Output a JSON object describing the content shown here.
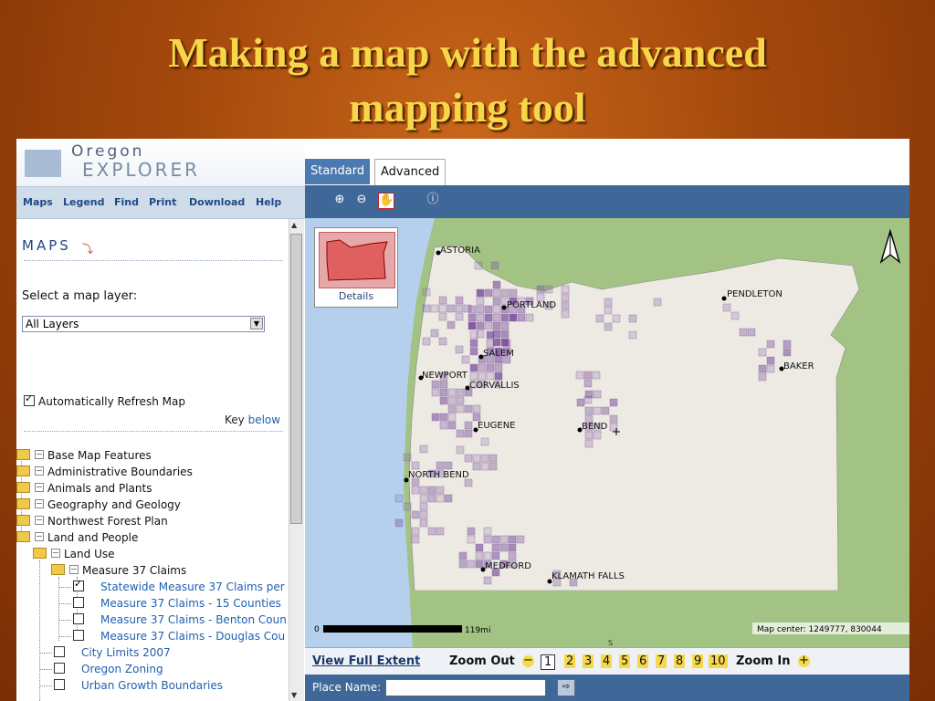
{
  "slide": {
    "title_line1": "Making a map with the advanced",
    "title_line2": "mapping tool"
  },
  "logo": {
    "line1": "Oregon",
    "line2": "EXPLORER"
  },
  "menu": [
    "Maps",
    "Legend",
    "Find",
    "Print",
    "Download",
    "Help"
  ],
  "maps_panel": {
    "header": "MAPS",
    "select_label": "Select a map layer:",
    "select_value": "All Layers",
    "auto_refresh_label": "Automatically Refresh Map",
    "auto_refresh_checked": true,
    "key_label": "Key",
    "key_link": "below"
  },
  "tree": [
    {
      "label": "Base Map Features"
    },
    {
      "label": "Administrative Boundaries"
    },
    {
      "label": "Animals and Plants"
    },
    {
      "label": "Geography and Geology"
    },
    {
      "label": "Northwest Forest Plan"
    },
    {
      "label": "Land and People"
    },
    {
      "label": "Land Use"
    },
    {
      "label": "Measure 37 Claims"
    },
    {
      "label": "Statewide Measure 37 Claims per",
      "checked": true
    },
    {
      "label": "Measure 37 Claims - 15 Counties"
    },
    {
      "label": "Measure 37 Claims - Benton Coun"
    },
    {
      "label": "Measure 37 Claims - Douglas Cou"
    },
    {
      "label": "City Limits 2007"
    },
    {
      "label": "Oregon Zoning"
    },
    {
      "label": "Urban Growth Boundaries"
    }
  ],
  "tabs": {
    "standard": "Standard",
    "advanced": "Advanced"
  },
  "inset": {
    "label": "Details"
  },
  "cities": [
    "ASTORIA",
    "PORTLAND",
    "PENDLETON",
    "SALEM",
    "NEWPORT",
    "CORVALLIS",
    "BAKER",
    "EUGENE",
    "BEND",
    "NORTH BEND",
    "MEDFORD",
    "KLAMATH FALLS"
  ],
  "scale": {
    "start": "0",
    "end": "119mi"
  },
  "map_center": "Map center: 1249777, 830044",
  "compass": {
    "south": "S"
  },
  "nav": {
    "full_extent": "View Full Extent",
    "zoom_out": "Zoom Out",
    "zoom_in": "Zoom In",
    "minus": "−",
    "plus": "+",
    "levels": [
      "1",
      "2",
      "3",
      "4",
      "5",
      "6",
      "7",
      "8",
      "9",
      "10"
    ],
    "selected_level": "1"
  },
  "place": {
    "label": "Place Name:",
    "value": "",
    "go": "⇨"
  },
  "colors": {
    "title": "#f7d64a",
    "toolbar": "#3f6898",
    "oregon": "#eceae2",
    "ocean": "#b4d0ec",
    "land": "#a3c384",
    "claims": "#8a5aa8"
  }
}
